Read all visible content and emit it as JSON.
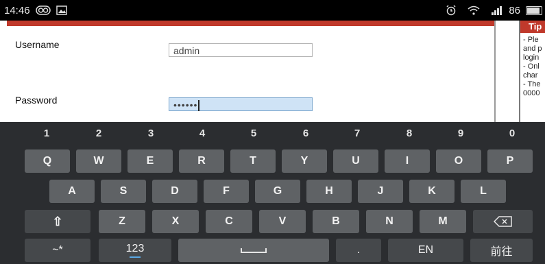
{
  "status": {
    "time": "14:46",
    "battery": "86",
    "left_icons": [
      "infinity-icon",
      "image-icon"
    ],
    "right_icons": [
      "alarm-icon",
      "wifi-icon",
      "signal-icon",
      "battery-icon"
    ]
  },
  "form": {
    "username_label": "Username",
    "username_value": "admin",
    "password_label": "Password",
    "password_value": "••••••"
  },
  "tips": {
    "title": "Tip",
    "lines": [
      "- Ple",
      "and p",
      "login",
      "- Onl",
      "char",
      "- The",
      "0000"
    ]
  },
  "keyboard": {
    "numbers": [
      "1",
      "2",
      "3",
      "4",
      "5",
      "6",
      "7",
      "8",
      "9",
      "0"
    ],
    "row1": [
      "Q",
      "W",
      "E",
      "R",
      "T",
      "Y",
      "U",
      "I",
      "O",
      "P"
    ],
    "row2": [
      "A",
      "S",
      "D",
      "F",
      "G",
      "H",
      "J",
      "K",
      "L"
    ],
    "row3": [
      "Z",
      "X",
      "C",
      "V",
      "B",
      "N",
      "M"
    ],
    "bottom": {
      "symbols": "~*",
      "numbers": "123",
      "period": ".",
      "language": "EN",
      "go": "前往"
    }
  },
  "colors": {
    "accent_red": "#c0392b",
    "focus_field": "#cfe3f6",
    "keyboard_bg": "#2b2d30",
    "key_bg": "#5f6265"
  }
}
